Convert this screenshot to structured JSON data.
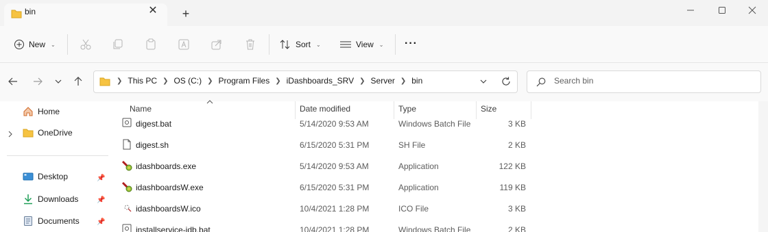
{
  "window": {
    "tab_title": "bin",
    "tab_close": "✕",
    "tab_add": "+"
  },
  "toolbar": {
    "new_label": "New",
    "sort_label": "Sort",
    "view_label": "View",
    "more_label": "···"
  },
  "address": {
    "crumbs": [
      "This PC",
      "OS (C:)",
      "Program Files",
      "iDashboards_SRV",
      "Server",
      "bin"
    ]
  },
  "search": {
    "placeholder": "Search bin"
  },
  "sidebar": {
    "home": "Home",
    "onedrive": "OneDrive",
    "desktop": "Desktop",
    "downloads": "Downloads",
    "documents": "Documents"
  },
  "columns": {
    "name": "Name",
    "date": "Date modified",
    "type": "Type",
    "size": "Size"
  },
  "files": [
    {
      "name": "digest.bat",
      "date": "5/14/2020 9:53 AM",
      "type": "Windows Batch File",
      "size": "3 KB",
      "icon": "batch-file-icon"
    },
    {
      "name": "digest.sh",
      "date": "6/15/2020 5:31 PM",
      "type": "SH File",
      "size": "2 KB",
      "icon": "generic-file-icon"
    },
    {
      "name": "idashboards.exe",
      "date": "5/14/2020 9:53 AM",
      "type": "Application",
      "size": "122 KB",
      "icon": "application-icon"
    },
    {
      "name": "idashboardsW.exe",
      "date": "6/15/2020 5:31 PM",
      "type": "Application",
      "size": "119 KB",
      "icon": "application-icon"
    },
    {
      "name": "idashboardsW.ico",
      "date": "10/4/2021 1:28 PM",
      "type": "ICO File",
      "size": "3 KB",
      "icon": "ico-file-icon"
    },
    {
      "name": "installservice-idb.bat",
      "date": "10/4/2021 1:28 PM",
      "type": "Windows Batch File",
      "size": "2 KB",
      "icon": "batch-file-icon"
    }
  ],
  "colors": {
    "folder": "#f6c342",
    "accent": "#0067c0",
    "border": "#d9d9d9"
  }
}
